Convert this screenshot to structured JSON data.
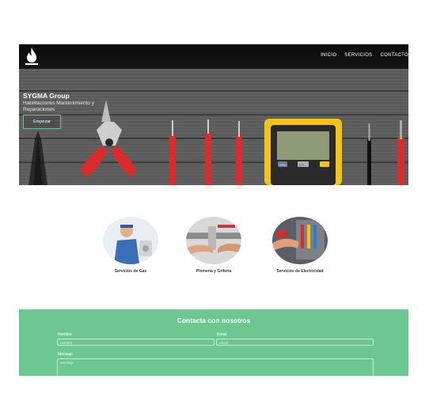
{
  "nav": {
    "items": [
      {
        "label": "INICIO"
      },
      {
        "label": "SERVICIOS"
      },
      {
        "label": "CONTACTO"
      }
    ]
  },
  "hero": {
    "brand": "SYGMA Group",
    "tagline": "Habilitaciones Mantenimiento y Reparaciones",
    "cta_label": "Empezar",
    "multimeter_readout": "",
    "meter_buttons": [
      "HOLD",
      "Ω %"
    ]
  },
  "services": [
    {
      "label": "Servicios de Gas"
    },
    {
      "label": "Plomería y Grifería"
    },
    {
      "label": "Servicios de Electricidad"
    }
  ],
  "contact": {
    "title": "Contacta con nosotros",
    "name_label": "Nombre",
    "name_placeholder": "nombre",
    "email_label": "Email",
    "email_placeholder": "email",
    "message_label": "Mensaje",
    "message_placeholder": "Mensaje"
  },
  "colors": {
    "accent": "#6cc890",
    "navbar": "#0b0b0b",
    "tool_red": "#d92b2b",
    "meter_yellow": "#f3c21b"
  }
}
